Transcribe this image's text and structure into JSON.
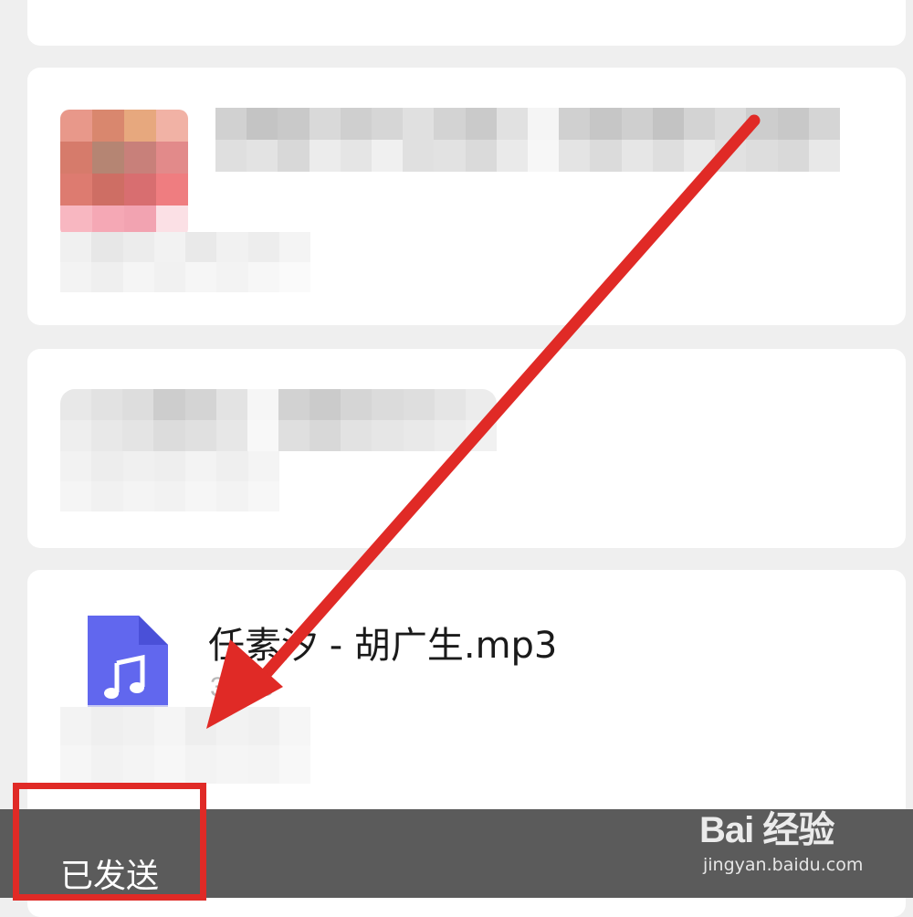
{
  "file_message": {
    "icon": "music-file-icon",
    "name": "任素汐 - 胡广生.mp3",
    "size": "3.MB"
  },
  "toast": {
    "text": "已发送"
  },
  "watermark": {
    "logo": "Bai 经验",
    "url": "jingyan.baidu.com"
  },
  "colors": {
    "annotation_red": "#e02a26",
    "file_icon_blue": "#6167ee",
    "toast_bg": "#5b5b5b",
    "background": "#efefef"
  }
}
